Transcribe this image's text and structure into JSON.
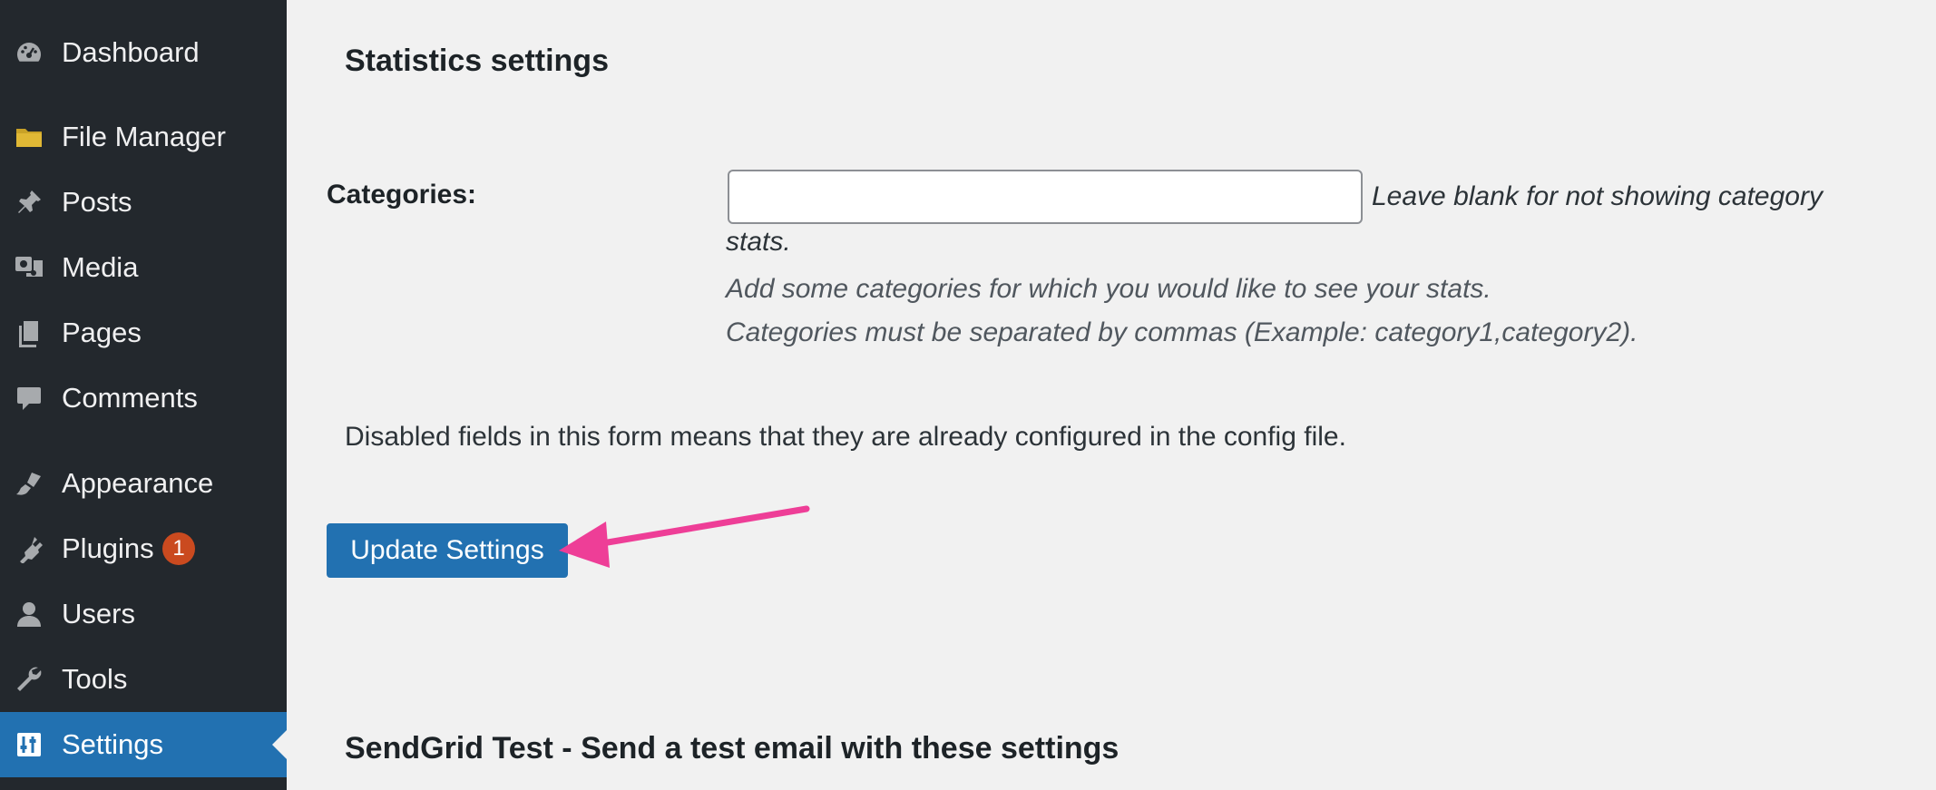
{
  "sidebar": {
    "items": [
      {
        "label": "Dashboard",
        "icon": "dashboard-icon"
      },
      {
        "label": "File Manager",
        "icon": "folder-icon"
      },
      {
        "label": "Posts",
        "icon": "pin-icon"
      },
      {
        "label": "Media",
        "icon": "media-icon"
      },
      {
        "label": "Pages",
        "icon": "pages-icon"
      },
      {
        "label": "Comments",
        "icon": "comment-icon"
      },
      {
        "label": "Appearance",
        "icon": "brush-icon"
      },
      {
        "label": "Plugins",
        "icon": "plugin-icon",
        "badge": "1"
      },
      {
        "label": "Users",
        "icon": "user-icon"
      },
      {
        "label": "Tools",
        "icon": "wrench-icon"
      },
      {
        "label": "Settings",
        "icon": "settings-icon",
        "current": true
      }
    ]
  },
  "main": {
    "stats_title": "Statistics settings",
    "categories": {
      "label": "Categories:",
      "value": "",
      "hint_inline": "Leave blank for not showing category",
      "hint_cont": "stats.",
      "desc1": "Add some categories for which you would like to see your stats.",
      "desc2": "Categories must be separated by commas (Example: category1,category2)."
    },
    "disabled_note": "Disabled fields in this form means that they are already configured in the config file.",
    "update_button": "Update Settings",
    "test_title": "SendGrid Test - Send a test email with these settings"
  },
  "colors": {
    "sidebar_bg": "#23282d",
    "accent": "#2271b1",
    "annotation_arrow": "#ee3e97",
    "badge": "#ca4a1f"
  }
}
